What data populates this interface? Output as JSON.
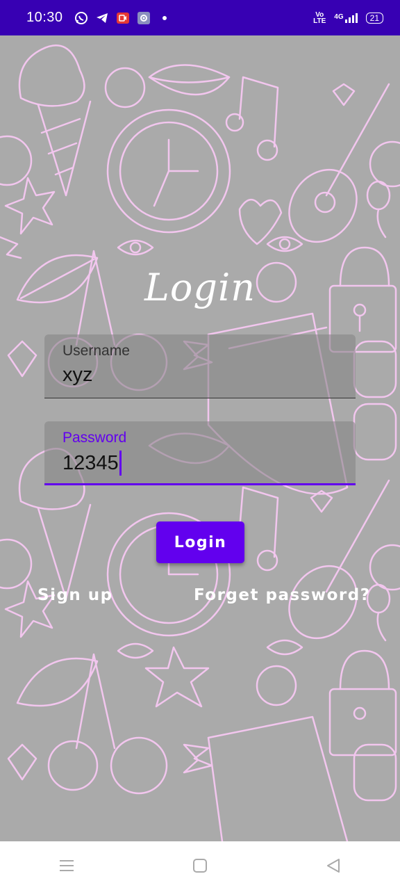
{
  "status_bar": {
    "time": "10:30",
    "network_top": "Vo",
    "network_bottom": "LTE",
    "signal_label": "4G",
    "battery": "21",
    "icons": [
      "whatsapp-icon",
      "telegram-icon",
      "screen-record-icon",
      "settings-app-icon",
      "notification-dot-icon",
      "signal-icon",
      "battery-icon"
    ]
  },
  "login": {
    "title": "Login",
    "username": {
      "label": "Username",
      "value": "xyz"
    },
    "password": {
      "label": "Password",
      "value": "12345"
    },
    "button_label": "Login",
    "signup_label": "Sign up",
    "forget_label": "Forget password?"
  },
  "colors": {
    "status_bar": "#3700b3",
    "accent": "#6200ee",
    "background": "#aaaaaa",
    "doodle_line": "#f2c6ee"
  },
  "nav_bar": {
    "icons": [
      "menu-icon",
      "home-icon",
      "back-icon"
    ]
  }
}
